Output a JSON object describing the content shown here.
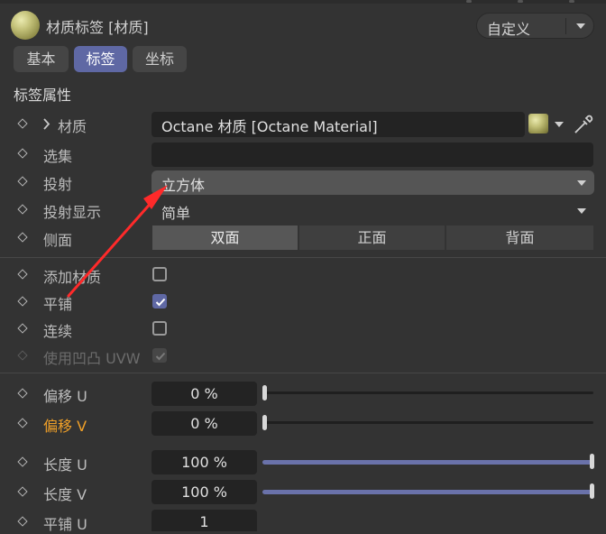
{
  "header": {
    "title": "材质标签 [材质]",
    "mode_dropdown": "自定义"
  },
  "tabs": [
    {
      "label": "基本",
      "active": false
    },
    {
      "label": "标签",
      "active": true
    },
    {
      "label": "坐标",
      "active": false
    }
  ],
  "section_title": "标签属性",
  "properties": {
    "material": {
      "label": "材质",
      "value": "Octane 材质 [Octane Material]"
    },
    "selection": {
      "label": "选集",
      "value": ""
    },
    "projection": {
      "label": "投射",
      "value": "立方体"
    },
    "projection_display": {
      "label": "投射显示",
      "value": "简单"
    },
    "side": {
      "label": "侧面",
      "options": [
        "双面",
        "正面",
        "背面"
      ],
      "selected": "双面"
    },
    "add_material": {
      "label": "添加材质",
      "checked": false
    },
    "tile": {
      "label": "平铺",
      "checked": true
    },
    "seamless": {
      "label": "连续",
      "checked": false
    },
    "use_bump_uvw": {
      "label": "使用凹凸 UVW",
      "checked": true,
      "disabled": true
    },
    "offset_u": {
      "label": "偏移 U",
      "value": "0 %",
      "fraction": 0.0
    },
    "offset_v": {
      "label": "偏移 V",
      "value": "0 %",
      "fraction": 0.0,
      "highlight": "#f0a028"
    },
    "length_u": {
      "label": "长度 U",
      "value": "100 %",
      "fraction": 1.0
    },
    "length_v": {
      "label": "长度 V",
      "value": "100 %",
      "fraction": 1.0
    },
    "tiles_u": {
      "label": "平铺 U",
      "value": "1"
    }
  },
  "colors": {
    "accent": "#5f68a4",
    "annotation_arrow": "#ff2a2a",
    "background": "#333333"
  }
}
